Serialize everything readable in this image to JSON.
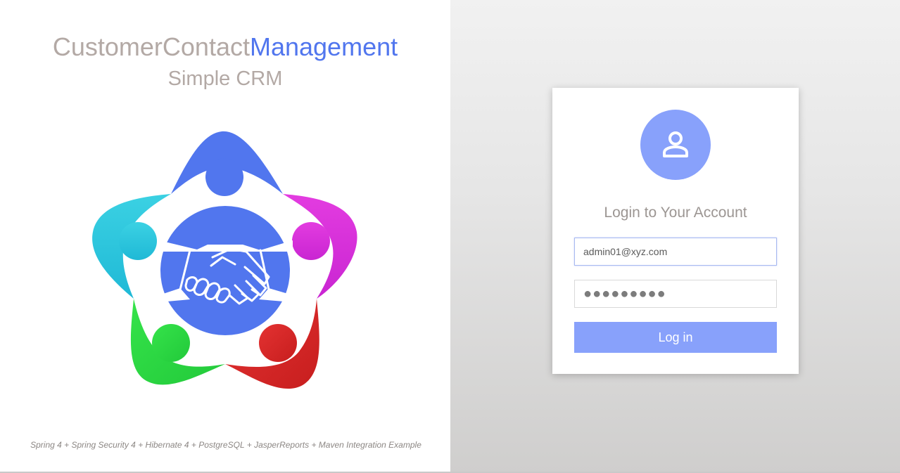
{
  "brand": {
    "title_part1": "CustomerContact",
    "title_part2": "Management",
    "subtitle": "Simple CRM"
  },
  "footer": {
    "text": "Spring 4 + Spring Security 4 + Hibernate 4 + PostgreSQL + JasperReports + Maven Integration Example"
  },
  "login": {
    "avatar_icon": "user-icon",
    "title": "Login to Your Account",
    "email_value": "admin01@xyz.com",
    "password_value": "●●●●●●●●●",
    "button_label": "Log in"
  },
  "colors": {
    "accent": "#5176ee",
    "button": "#88a1fb",
    "muted_text": "#b3a9a5",
    "logo_blue": "#5176ee",
    "logo_cyan": "#22c4da",
    "logo_magenta": "#d42ed9",
    "logo_green": "#2bd93e",
    "logo_red": "#d52424"
  }
}
